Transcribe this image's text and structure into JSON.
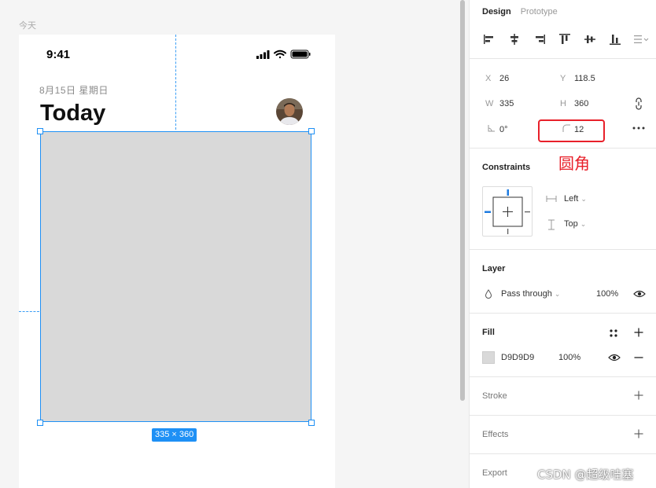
{
  "canvas": {
    "frame_label": "今天",
    "status_time": "9:41",
    "date": "8月15日 星期日",
    "title": "Today",
    "size_badge": "335 × 360"
  },
  "panel": {
    "tabs": {
      "design": "Design",
      "prototype": "Prototype"
    },
    "geometry": {
      "x_label": "X",
      "x_value": "26",
      "y_label": "Y",
      "y_value": "118.5",
      "w_label": "W",
      "w_value": "335",
      "h_label": "H",
      "h_value": "360",
      "rotation_value": "0°",
      "radius_value": "12"
    },
    "annotation": "圆角",
    "constraints": {
      "title": "Constraints",
      "horizontal": "Left",
      "vertical": "Top"
    },
    "layer": {
      "title": "Layer",
      "blend_mode": "Pass through",
      "opacity": "100%"
    },
    "fill": {
      "title": "Fill",
      "hex": "D9D9D9",
      "opacity": "100%",
      "color": "#d9d9d9"
    },
    "stroke": {
      "title": "Stroke"
    },
    "effects": {
      "title": "Effects"
    },
    "export": {
      "title": "Export"
    }
  },
  "watermark": "CSDN @超级哇塞",
  "colors": {
    "selection": "#1e90f5",
    "annotation": "#e8202a"
  }
}
